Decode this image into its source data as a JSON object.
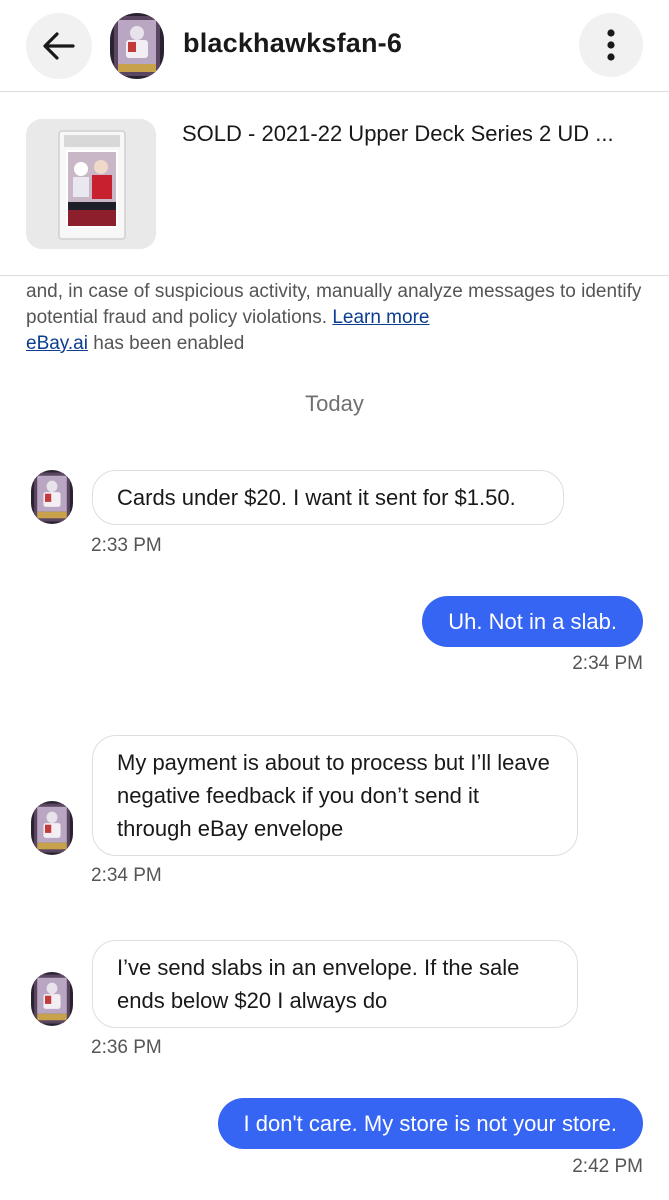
{
  "header": {
    "username": "blackhawksfan-6",
    "back_icon": "arrow-left-icon",
    "more_icon": "vertical-ellipsis-icon"
  },
  "listing": {
    "title": "SOLD - 2021-22 Upper Deck Series 2 UD ..."
  },
  "notice": {
    "text": "and, in case of suspicious activity, manually analyze messages to identify potential fraud and policy violations.",
    "learn_more": "Learn more",
    "ai_link": "eBay.ai",
    "ai_text": " has been enabled"
  },
  "day_label": "Today",
  "messages": [
    {
      "direction": "incoming",
      "text": "Cards under $20. I want it sent for $1.50.",
      "time": "2:33 PM"
    },
    {
      "direction": "outgoing",
      "text": "Uh. Not in a slab.",
      "time": "2:34 PM"
    },
    {
      "direction": "incoming",
      "text": "My payment is about to process but I’ll leave negative feedback if you don’t send it through eBay envelope",
      "time": "2:34 PM"
    },
    {
      "direction": "incoming",
      "text": "I’ve send slabs in an envelope. If the sale ends below $20 I always do",
      "time": "2:36 PM"
    },
    {
      "direction": "outgoing",
      "text": "I don't care. My store is not your store.",
      "time": "2:42 PM"
    }
  ],
  "colors": {
    "outgoing_bubble": "#3665f3",
    "link": "#0b3d91"
  }
}
